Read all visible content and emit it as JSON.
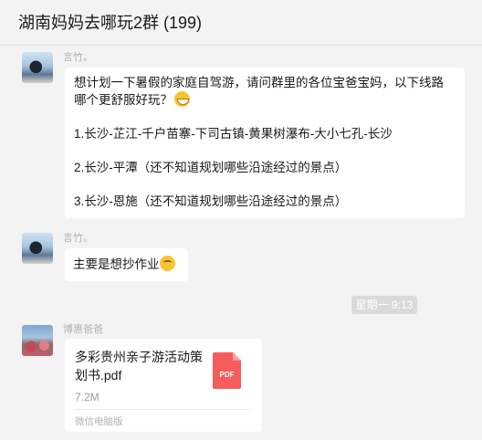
{
  "header": {
    "title": "湖南妈妈去哪玩2群 (199)"
  },
  "messages": [
    {
      "sender": "言竹。",
      "lines": [
        "想计划一下暑假的家庭自驾游，请问群里的各位宝爸宝妈，以下线路",
        "哪个更舒服好玩？",
        "1.长沙-芷江-千户苗寨-下司古镇-黄果树瀑布-大小七孔-长沙",
        "2.长沙-平潭（还不知道规划哪些沿途经过的景点）",
        "3.长沙-恩施（还不知道规划哪些沿途经过的景点）"
      ],
      "emoji": "grin-emoji"
    },
    {
      "sender": "言竹。",
      "text": "主要是想抄作业",
      "emoji": "tired-face-emoji"
    }
  ],
  "time_divider": "星期一 9:13",
  "file_message": {
    "sender": "博惠爸爸",
    "file_name": "多彩贵州亲子游活动策划书.pdf",
    "file_size": "7.2M",
    "source": "微信电脑版",
    "file_type": "PDF",
    "icon": "pdf-file-icon",
    "icon_color": "#f55c5c"
  },
  "colors": {
    "background": "#f3f3f3",
    "bubble": "#ffffff",
    "sender_name": "#b2b2b2",
    "time_badge": "#dadada"
  }
}
